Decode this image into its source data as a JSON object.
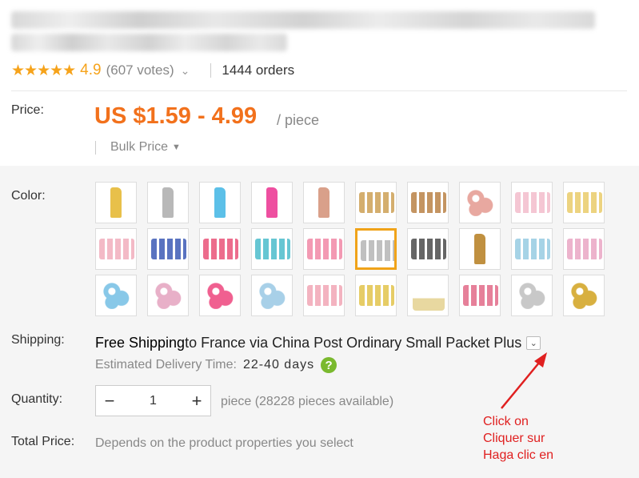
{
  "rating": {
    "stars": "★★★★★",
    "score": "4.9",
    "votes": "(607 votes)",
    "orders": "1444 orders"
  },
  "price": {
    "label": "Price:",
    "value": "US $1.59 - 4.99",
    "unit": "/ piece",
    "bulk": "Bulk Price"
  },
  "color": {
    "label": "Color:",
    "selected_index": 15,
    "swatch_count": 30
  },
  "shipping": {
    "label": "Shipping:",
    "free": "Free Shipping",
    "rest": " to France via China Post Ordinary Small Packet Plus",
    "est_label": "Estimated Delivery Time:",
    "est_days": "22-40 days"
  },
  "quantity": {
    "label": "Quantity:",
    "value": "1",
    "minus": "−",
    "plus": "+",
    "available": "piece (28228 pieces available)"
  },
  "total": {
    "label": "Total Price:",
    "value": "Depends on the product properties you select"
  },
  "annotation": {
    "line1": "Click on",
    "line2": "Cliquer sur",
    "line3": "Haga clic en"
  },
  "colors": {
    "orange": "#f2711c",
    "star": "#f6a31b",
    "selected_border": "#f0a319",
    "annotation": "#e02020"
  }
}
